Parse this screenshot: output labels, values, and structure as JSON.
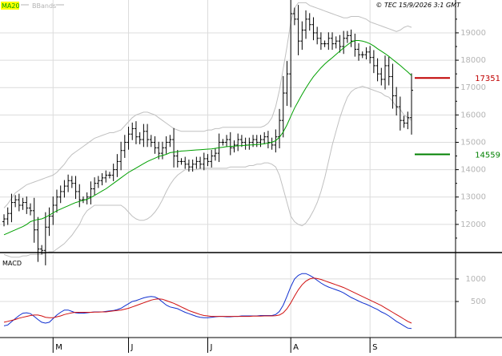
{
  "legend": [
    {
      "label": "MA20",
      "color": "#00a000"
    },
    {
      "label": "BBands",
      "color": "#b4b4b4"
    }
  ],
  "copyright": "© TEC 15/9/2026 3:1 GMT",
  "colors": {
    "candle": "#000000",
    "ma": "#00a000",
    "bands": "#c0c0c0",
    "grid": "#dcdcdc",
    "axis_text": "#b4b4b4",
    "resistance": "#c00000",
    "support": "#008000",
    "macd": "#1030d0",
    "signal": "#d01010"
  },
  "chart_data": [
    {
      "type": "candlestick",
      "name": "price",
      "ylim": [
        11000,
        20200
      ],
      "y_ticks": [
        12000,
        13000,
        14000,
        15000,
        16000,
        17000,
        18000,
        19000
      ],
      "x_ticks": [
        {
          "label": "M",
          "i": 13
        },
        {
          "label": "J",
          "i": 33
        },
        {
          "label": "J",
          "i": 54
        },
        {
          "label": "A",
          "i": 76
        },
        {
          "label": "S",
          "i": 97
        }
      ],
      "levels": [
        {
          "name": "resistance",
          "value": 17351,
          "label": "17351",
          "color": "#c00000"
        },
        {
          "name": "support",
          "value": 14559,
          "label": "14559",
          "color": "#008000"
        }
      ],
      "close": [
        12200,
        12400,
        12800,
        12900,
        12700,
        12800,
        12600,
        12500,
        11800,
        11100,
        11050,
        11900,
        12300,
        12700,
        13000,
        13200,
        13400,
        13600,
        13500,
        13200,
        12900,
        12900,
        13000,
        13300,
        13500,
        13600,
        13700,
        13800,
        13800,
        14000,
        14300,
        14700,
        15000,
        15300,
        15500,
        15200,
        15100,
        15400,
        15100,
        15000,
        14800,
        14600,
        14800,
        15000,
        15100,
        14500,
        14300,
        14300,
        14200,
        14100,
        14200,
        14300,
        14200,
        14400,
        14300,
        14500,
        14600,
        15000,
        15000,
        15100,
        14800,
        14900,
        15100,
        15000,
        14900,
        15000,
        15100,
        15000,
        15100,
        15200,
        15000,
        14900,
        15200,
        15800,
        16800,
        17500,
        19700,
        19500,
        18700,
        19100,
        19500,
        19300,
        19000,
        18800,
        18600,
        18600,
        18800,
        18600,
        18700,
        18500,
        18800,
        18900,
        18700,
        18400,
        18200,
        18200,
        18300,
        18100,
        17800,
        17500,
        17300,
        17800,
        17400,
        16700,
        16300,
        15800,
        15700,
        15900,
        16900
      ],
      "ma20": [
        11620,
        11680,
        11740,
        11800,
        11860,
        11920,
        12000,
        12100,
        12150,
        12180,
        12200,
        12260,
        12340,
        12420,
        12500,
        12560,
        12620,
        12680,
        12740,
        12800,
        12840,
        12880,
        12920,
        12980,
        13060,
        13140,
        13220,
        13300,
        13400,
        13500,
        13600,
        13700,
        13800,
        13900,
        13980,
        14060,
        14140,
        14220,
        14300,
        14360,
        14420,
        14480,
        14520,
        14560,
        14620,
        14640,
        14660,
        14680,
        14690,
        14700,
        14710,
        14720,
        14730,
        14740,
        14750,
        14760,
        14780,
        14800,
        14820,
        14840,
        14850,
        14860,
        14870,
        14880,
        14890,
        14900,
        14910,
        14920,
        14930,
        14950,
        14970,
        15000,
        15060,
        15180,
        15380,
        15640,
        15950,
        16250,
        16500,
        16750,
        16980,
        17200,
        17400,
        17560,
        17720,
        17860,
        17980,
        18090,
        18210,
        18330,
        18450,
        18560,
        18660,
        18720,
        18720,
        18700,
        18660,
        18600,
        18520,
        18420,
        18330,
        18240,
        18140,
        18030,
        17920,
        17810,
        17690,
        17570,
        17440
      ],
      "bb_upper": [
        12600,
        12750,
        12950,
        13150,
        13250,
        13350,
        13450,
        13500,
        13550,
        13600,
        13650,
        13700,
        13750,
        13800,
        13900,
        14050,
        14200,
        14400,
        14550,
        14650,
        14750,
        14850,
        14950,
        15050,
        15150,
        15200,
        15250,
        15300,
        15350,
        15350,
        15400,
        15450,
        15600,
        15750,
        15900,
        16000,
        16050,
        16100,
        16100,
        16050,
        16000,
        15900,
        15800,
        15700,
        15600,
        15500,
        15450,
        15400,
        15400,
        15400,
        15400,
        15400,
        15400,
        15400,
        15450,
        15450,
        15500,
        15500,
        15550,
        15550,
        15550,
        15550,
        15550,
        15550,
        15550,
        15550,
        15550,
        15550,
        15550,
        15600,
        15700,
        15900,
        16300,
        16900,
        17700,
        18500,
        19400,
        19900,
        20100,
        20100,
        20100,
        20000,
        19950,
        19900,
        19850,
        19800,
        19750,
        19700,
        19650,
        19600,
        19550,
        19550,
        19600,
        19600,
        19600,
        19550,
        19500,
        19400,
        19350,
        19300,
        19250,
        19200,
        19150,
        19100,
        19050,
        19100,
        19200,
        19250,
        19200
      ],
      "bb_lower": [
        10900,
        10850,
        10800,
        10800,
        10800,
        10850,
        10850,
        10900,
        10900,
        10900,
        10900,
        10950,
        11000,
        11000,
        11100,
        11200,
        11300,
        11450,
        11600,
        11800,
        12000,
        12300,
        12500,
        12600,
        12700,
        12700,
        12700,
        12700,
        12700,
        12700,
        12700,
        12700,
        12600,
        12450,
        12300,
        12200,
        12150,
        12150,
        12200,
        12300,
        12450,
        12650,
        12900,
        13200,
        13450,
        13650,
        13800,
        13900,
        14000,
        14000,
        14000,
        14000,
        14050,
        14050,
        14050,
        14050,
        14050,
        14050,
        14050,
        14050,
        14100,
        14100,
        14100,
        14100,
        14100,
        14150,
        14150,
        14200,
        14200,
        14250,
        14250,
        14200,
        14100,
        13800,
        13300,
        12800,
        12300,
        12100,
        12000,
        11950,
        12050,
        12250,
        12500,
        12800,
        13200,
        13700,
        14300,
        14900,
        15400,
        15900,
        16300,
        16650,
        16850,
        16950,
        17000,
        17050,
        17000,
        16950,
        16900,
        16850,
        16800,
        16700,
        16650,
        16500,
        16300,
        16200,
        16000,
        15900,
        15800
      ]
    },
    {
      "type": "line",
      "name": "MACD",
      "title": "MACD",
      "ylim": [
        -300,
        1550
      ],
      "y_ticks": [
        500,
        1000
      ],
      "series": [
        {
          "color": "#1030d0",
          "values": [
            -40,
            -20,
            50,
            120,
            190,
            240,
            250,
            230,
            170,
            100,
            40,
            20,
            40,
            120,
            200,
            260,
            310,
            310,
            280,
            250,
            240,
            240,
            250,
            260,
            270,
            270,
            270,
            280,
            290,
            300,
            320,
            350,
            400,
            450,
            500,
            520,
            550,
            580,
            600,
            610,
            600,
            560,
            490,
            420,
            380,
            360,
            340,
            300,
            260,
            230,
            200,
            170,
            150,
            140,
            140,
            150,
            160,
            170,
            170,
            160,
            160,
            170,
            170,
            180,
            180,
            180,
            180,
            180,
            190,
            190,
            190,
            190,
            210,
            280,
            420,
            620,
            830,
            1000,
            1080,
            1120,
            1120,
            1080,
            1030,
            970,
            910,
            860,
            820,
            790,
            760,
            730,
            690,
            640,
            590,
            550,
            510,
            470,
            440,
            400,
            360,
            320,
            270,
            230,
            180,
            120,
            60,
            10,
            -40,
            -90,
            -100
          ]
        },
        {
          "color": "#d01010",
          "values": [
            40,
            60,
            80,
            100,
            130,
            150,
            170,
            190,
            200,
            200,
            180,
            150,
            140,
            140,
            160,
            180,
            210,
            230,
            250,
            260,
            260,
            260,
            260,
            260,
            265,
            265,
            270,
            270,
            280,
            290,
            300,
            310,
            330,
            350,
            380,
            410,
            440,
            470,
            500,
            530,
            550,
            560,
            550,
            520,
            490,
            460,
            420,
            380,
            340,
            300,
            270,
            240,
            210,
            190,
            180,
            170,
            170,
            170,
            170,
            170,
            170,
            170,
            170,
            170,
            170,
            170,
            175,
            175,
            175,
            180,
            180,
            180,
            185,
            200,
            250,
            340,
            470,
            620,
            760,
            870,
            950,
            1000,
            1020,
            1010,
            990,
            960,
            930,
            900,
            870,
            840,
            810,
            770,
            730,
            690,
            650,
            610,
            570,
            530,
            490,
            450,
            410,
            360,
            310,
            260,
            210,
            160,
            110,
            60,
            20
          ]
        }
      ]
    }
  ]
}
